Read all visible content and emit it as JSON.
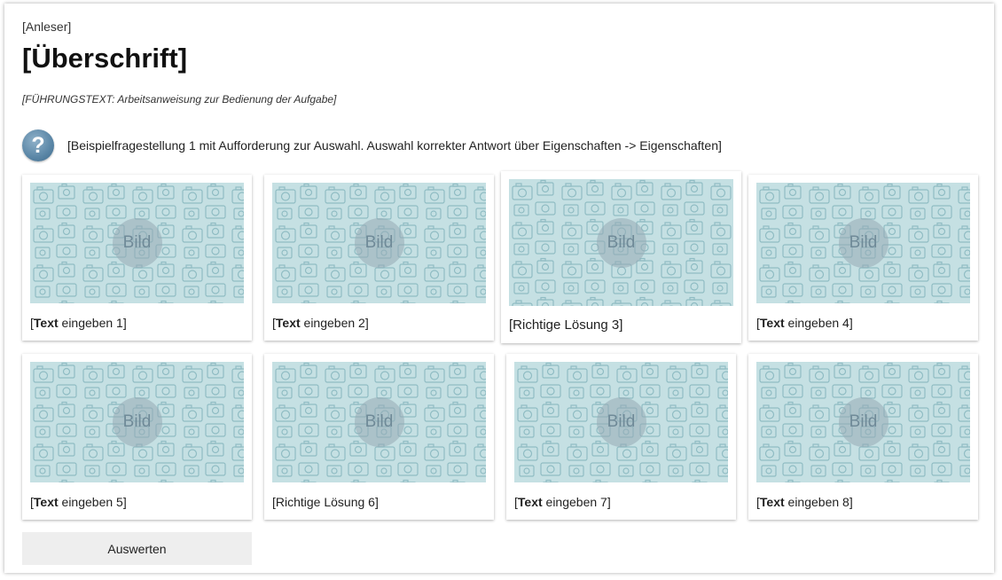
{
  "task": {
    "overline": "[Anleser]",
    "title": "[Überschrift]",
    "lead": "[FÜHRUNGSTEXT: Arbeitsanweisung zur Bedienung der Aufgabe]",
    "question": "[Beispielfragestellung 1 mit Aufforderung zur Auswahl. Auswahl korrekter Antwort über Eigenschaften -> Eigenschaften]",
    "help_icon_glyph": "?",
    "submit_label": "Auswerten"
  },
  "options": [
    {
      "image_label": "Bild",
      "bold": "Text",
      "rest": " eingeben 1",
      "open": "[",
      "close": "]"
    },
    {
      "image_label": "Bild",
      "bold": "Text",
      "rest": " eingeben 2",
      "open": "[",
      "close": "]"
    },
    {
      "image_label": "Bild",
      "bold": "",
      "rest": "Richtige Lösung 3",
      "open": "[",
      "close": "]"
    },
    {
      "image_label": "Bild",
      "bold": "Text",
      "rest": " eingeben 4",
      "open": "[",
      "close": "]"
    },
    {
      "image_label": "Bild",
      "bold": "Text",
      "rest": " eingeben 5",
      "open": "[",
      "close": "]"
    },
    {
      "image_label": "Bild",
      "bold": "",
      "rest": "Richtige Lösung 6",
      "open": "[",
      "close": "]"
    },
    {
      "image_label": "Bild",
      "bold": "Text",
      "rest": " eingeben 7",
      "open": "[",
      "close": "]"
    },
    {
      "image_label": "Bild",
      "bold": "Text",
      "rest": " eingeben 8",
      "open": "[",
      "close": "]"
    }
  ],
  "colors": {
    "image_placeholder_bg": "#c5e0e3",
    "image_pattern": "#8fbcc3",
    "help_icon": "#5a86a6",
    "submit_bg": "#eeeeee"
  }
}
